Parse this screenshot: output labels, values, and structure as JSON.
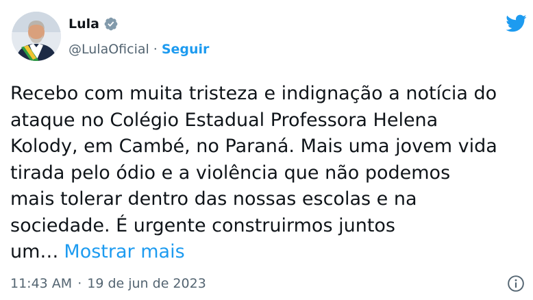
{
  "author": {
    "name": "Lula",
    "handle": "@LulaOficial",
    "separator": "·",
    "follow_label": "Seguir"
  },
  "tweet": {
    "lines": [
      "Recebo com muita tristeza e indignação a notícia do",
      "ataque no Colégio Estadual Professora Helena",
      "Kolody, em Cambé, no Paraná. Mais uma jovem vida",
      "tirada pelo ódio e a violência que não podemos",
      "mais tolerar dentro das nossas escolas e na",
      "sociedade. É urgente construirmos juntos",
      "um…"
    ],
    "show_more": "Mostrar mais"
  },
  "meta": {
    "time": "11:43 AM",
    "separator": "·",
    "date": "19 de jun de 2023"
  },
  "icons": {
    "verified": "verified-badge-icon",
    "brand": "twitter-bird-icon",
    "info": "info-icon"
  },
  "colors": {
    "accent": "#1d9bf0",
    "text": "#0f1419",
    "muted": "#536471"
  }
}
